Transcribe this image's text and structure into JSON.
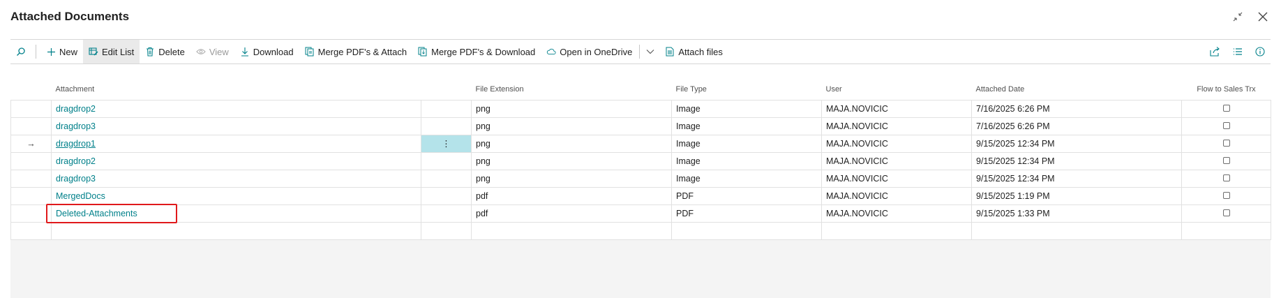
{
  "header": {
    "title": "Attached Documents"
  },
  "toolbar": {
    "new_label": "New",
    "edit_list_label": "Edit List",
    "delete_label": "Delete",
    "view_label": "View",
    "download_label": "Download",
    "merge_attach_label": "Merge PDF's & Attach",
    "merge_download_label": "Merge PDF's & Download",
    "onedrive_label": "Open in OneDrive",
    "attach_files_label": "Attach files"
  },
  "columns": {
    "attachment": "Attachment",
    "file_extension": "File Extension",
    "file_type": "File Type",
    "user": "User",
    "attached_date": "Attached Date",
    "flow_to_sales": "Flow to Sales Trx"
  },
  "rows": [
    {
      "attachment": "dragdrop2",
      "ext": "png",
      "type": "Image",
      "user": "MAJA.NOVICIC",
      "date": "7/16/2025 6:26 PM",
      "flow": false
    },
    {
      "attachment": "dragdrop3",
      "ext": "png",
      "type": "Image",
      "user": "MAJA.NOVICIC",
      "date": "7/16/2025 6:26 PM",
      "flow": false
    },
    {
      "attachment": "dragdrop1",
      "ext": "png",
      "type": "Image",
      "user": "MAJA.NOVICIC",
      "date": "9/15/2025 12:34 PM",
      "flow": false
    },
    {
      "attachment": "dragdrop2",
      "ext": "png",
      "type": "Image",
      "user": "MAJA.NOVICIC",
      "date": "9/15/2025 12:34 PM",
      "flow": false
    },
    {
      "attachment": "dragdrop3",
      "ext": "png",
      "type": "Image",
      "user": "MAJA.NOVICIC",
      "date": "9/15/2025 12:34 PM",
      "flow": false
    },
    {
      "attachment": "MergedDocs",
      "ext": "pdf",
      "type": "PDF",
      "user": "MAJA.NOVICIC",
      "date": "9/15/2025 1:19 PM",
      "flow": false
    },
    {
      "attachment": "Deleted-Attachments",
      "ext": "pdf",
      "type": "PDF",
      "user": "MAJA.NOVICIC",
      "date": "9/15/2025 1:33 PM",
      "flow": false
    }
  ],
  "current_row_marker": "→",
  "row_menu_glyph": "⋮",
  "colors": {
    "link": "#00808a",
    "selected_cell": "#b4e3ea",
    "highlight_box": "#e0191b"
  }
}
